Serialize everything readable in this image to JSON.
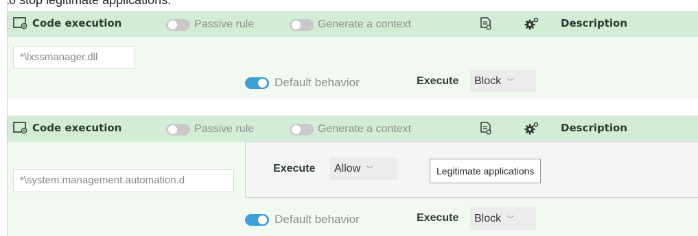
{
  "cropped_heading": "to stop legitimate applications.",
  "rules": [
    {
      "title": "Code execution",
      "passive_rule_label": "Passive rule",
      "generate_context_label": "Generate a context",
      "description_label": "Description",
      "path": "*\\lxssmanager.dll",
      "default_behavior_label": "Default behavior",
      "execute_label": "Execute",
      "execute_value": "Block"
    },
    {
      "title": "Code execution",
      "passive_rule_label": "Passive rule",
      "generate_context_label": "Generate a context",
      "description_label": "Description",
      "path": "*\\system.management.automation.d",
      "popup": {
        "execute_label": "Execute",
        "execute_value": "Allow",
        "group_button": "Legitimate applications"
      },
      "default_behavior_label": "Default behavior",
      "execute_label": "Execute",
      "execute_value": "Block"
    }
  ],
  "colors": {
    "header_bg": "#d3ecd5",
    "body_bg": "#f1f9f1",
    "toggle_on": "#3d9fd6",
    "toggle_off": "#c9c9c9"
  }
}
